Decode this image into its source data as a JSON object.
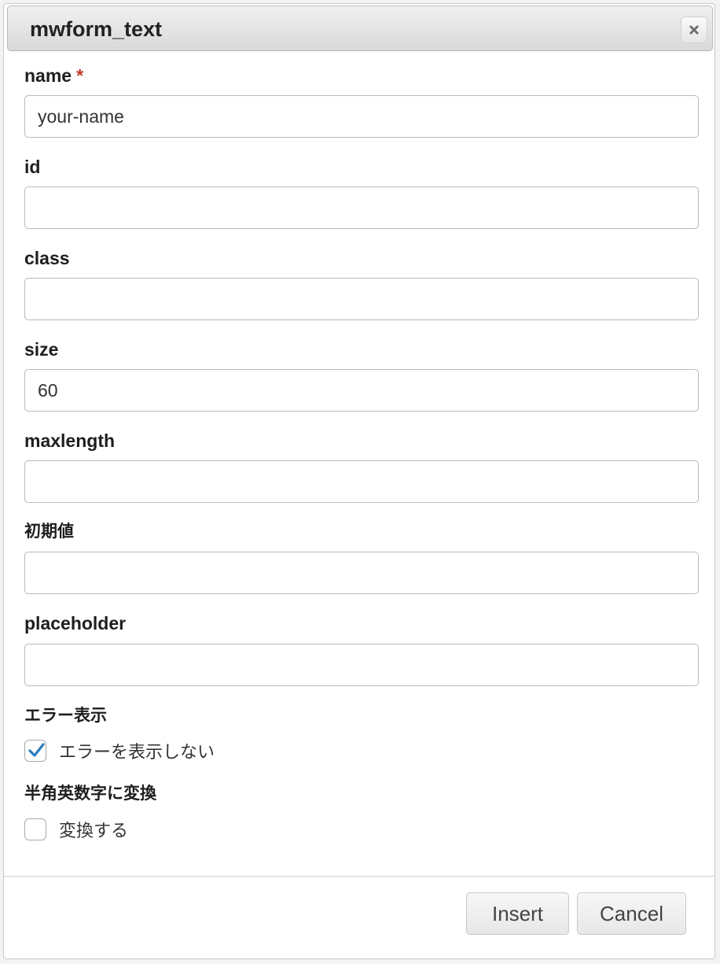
{
  "dialog": {
    "title": "mwform_text",
    "close_icon": "close-icon"
  },
  "fields": {
    "name": {
      "label": "name",
      "required_mark": "*",
      "value": "your-name"
    },
    "id": {
      "label": "id",
      "value": ""
    },
    "class": {
      "label": "class",
      "value": ""
    },
    "size": {
      "label": "size",
      "value": "60"
    },
    "maxlength": {
      "label": "maxlength",
      "value": ""
    },
    "initial_value": {
      "label": "初期値",
      "value": ""
    },
    "placeholder": {
      "label": "placeholder",
      "value": ""
    }
  },
  "error_display": {
    "label": "エラー表示",
    "checkbox_label": "エラーを表示しない",
    "checked": true
  },
  "convert_halfwidth": {
    "label": "半角英数字に変換",
    "checkbox_label": "変換する",
    "checked": false
  },
  "buttons": {
    "insert_label": "Insert",
    "cancel_label": "Cancel"
  },
  "colors": {
    "required": "#c0392b",
    "checkmark": "#2a7fbf"
  }
}
